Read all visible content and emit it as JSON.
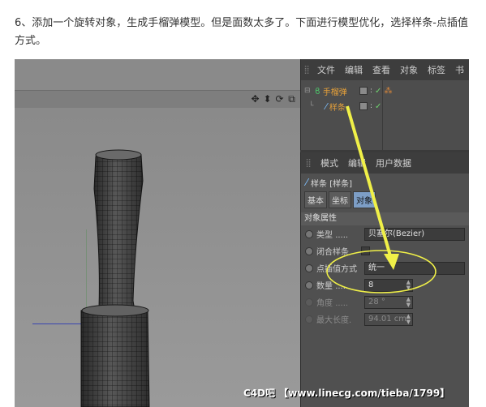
{
  "instruction": "6、添加一个旋转对象，生成手榴弹模型。但是面数太多了。下面进行模型优化，选择样条-点插值方式。",
  "viewport": {
    "header_icons": [
      "move-icon",
      "arrow-icon",
      "rotate-icon",
      "maximize-icon"
    ]
  },
  "object_manager": {
    "menu": [
      "文件",
      "编辑",
      "查看",
      "对象",
      "标签",
      "书"
    ],
    "objects": [
      {
        "name": "手榴弹",
        "icon": "lathe-icon"
      },
      {
        "name": "样条",
        "icon": "spline-icon"
      }
    ]
  },
  "attribute_manager": {
    "menu": [
      "模式",
      "编辑",
      "用户数据"
    ],
    "title": "样条 [样条]",
    "tabs": [
      "基本",
      "坐标",
      "对象"
    ],
    "active_tab": "对象",
    "section": "对象属性",
    "properties": [
      {
        "label": "类型",
        "dots": ".....",
        "value": "贝塞尔(Bezier)",
        "enabled": true
      },
      {
        "label": "闭合样条",
        "dots": "",
        "value": "",
        "enabled": true
      },
      {
        "label": "点插值方式",
        "dots": "",
        "value": "统一",
        "enabled": true
      },
      {
        "label": "数量",
        "dots": ".....",
        "value": "8",
        "enabled": true
      },
      {
        "label": "角度",
        "dots": ".....",
        "value": "28 °",
        "enabled": false
      },
      {
        "label": "最大长度",
        "dots": ".",
        "value": "94.01 cm",
        "enabled": false
      }
    ]
  },
  "colors": {
    "annotation_yellow": "#f0f048",
    "orange_label": "#e5a03a",
    "active_tab": "#7d9ec6"
  },
  "watermark": "C4D吧 【www.linecg.com/tieba/1799】"
}
